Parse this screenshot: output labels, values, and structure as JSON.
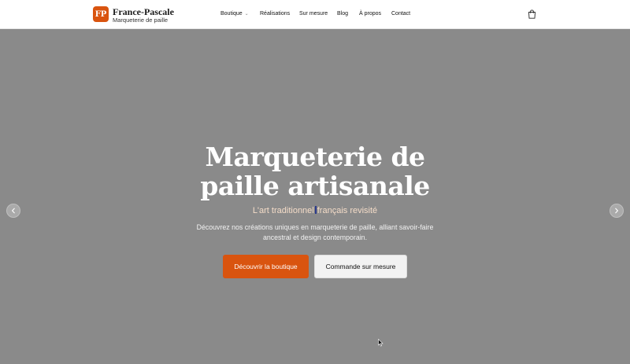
{
  "brand": {
    "logo": "FP",
    "name": "France-Pascale",
    "tagline": "Marqueterie de paille"
  },
  "nav": {
    "items": [
      {
        "label": "Boutique",
        "has_dropdown": true
      },
      {
        "label": "Réalisations"
      },
      {
        "label": "Sur mesure"
      },
      {
        "label": "Blog"
      },
      {
        "label": "À propos"
      },
      {
        "label": "Contact"
      }
    ],
    "cart_icon": "shopping-bag-icon"
  },
  "hero": {
    "title_line1": "Marqueterie de",
    "title_line2": "paille artisanale",
    "subtitle_part1": "L'art traditionnel",
    "subtitle_part2": "français revisité",
    "description": "Découvrez nos créations uniques en marqueterie de paille, alliant savoir-faire ancestral et design contemporain.",
    "primary_button": "Découvrir la boutique",
    "secondary_button": "Commande sur mesure",
    "prev_icon": "chevron-left-icon",
    "next_icon": "chevron-right-icon"
  },
  "colors": {
    "accent": "#d9540f",
    "hero_background": "#8a8a8a",
    "header_background": "#ffffff"
  }
}
